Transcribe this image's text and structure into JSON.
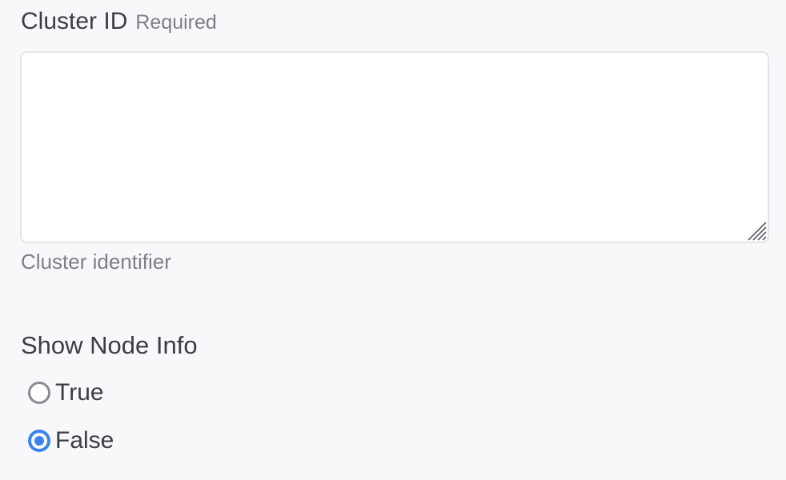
{
  "cluster_id": {
    "label": "Cluster ID",
    "required_tag": "Required",
    "value": "",
    "placeholder": "",
    "helper": "Cluster identifier"
  },
  "show_node_info": {
    "label": "Show Node Info",
    "options": [
      {
        "label": "True",
        "checked": false
      },
      {
        "label": "False",
        "checked": true
      }
    ]
  },
  "colors": {
    "accent": "#3b82f0",
    "background": "#f7f8fa",
    "muted_text": "#7c7f86"
  }
}
